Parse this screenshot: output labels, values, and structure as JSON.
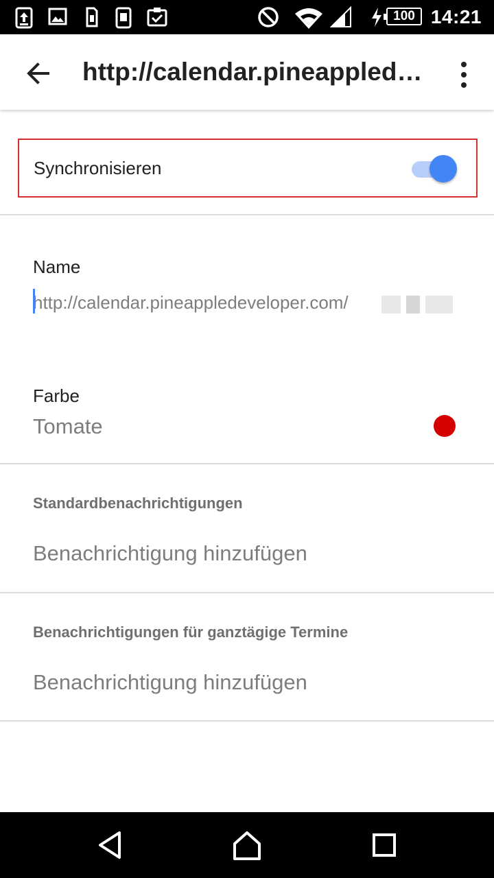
{
  "status_bar": {
    "time": "14:21",
    "battery": "100",
    "left_icons": [
      "upload-icon",
      "image-icon",
      "sim-icon",
      "phone-storage-icon",
      "clipboard-check-icon"
    ],
    "right_icons": [
      "do-not-disturb-icon",
      "wifi-icon",
      "signal-icon",
      "charging-icon",
      "battery-icon"
    ]
  },
  "app_bar": {
    "title": "http://calendar.pineappled…",
    "back_icon": "arrow-back-icon",
    "menu_icon": "more-vert-icon"
  },
  "sync": {
    "label": "Synchronisieren",
    "enabled": true,
    "accent": "#4285f4",
    "highlight_border": "#d32f2f"
  },
  "name": {
    "label": "Name",
    "value": "http://calendar.pineappledeveloper.com/"
  },
  "color": {
    "label": "Farbe",
    "value": "Tomate",
    "swatch": "#d50000"
  },
  "default_notifications": {
    "header": "Standardbenachrichtigungen",
    "add_label": "Benachrichtigung hinzufügen"
  },
  "all_day_notifications": {
    "header": "Benachrichtigungen für ganztägige Termine",
    "add_label": "Benachrichtigung hinzufügen"
  },
  "nav_bar": {
    "buttons": [
      "back-triangle-icon",
      "home-icon",
      "recents-icon"
    ]
  }
}
